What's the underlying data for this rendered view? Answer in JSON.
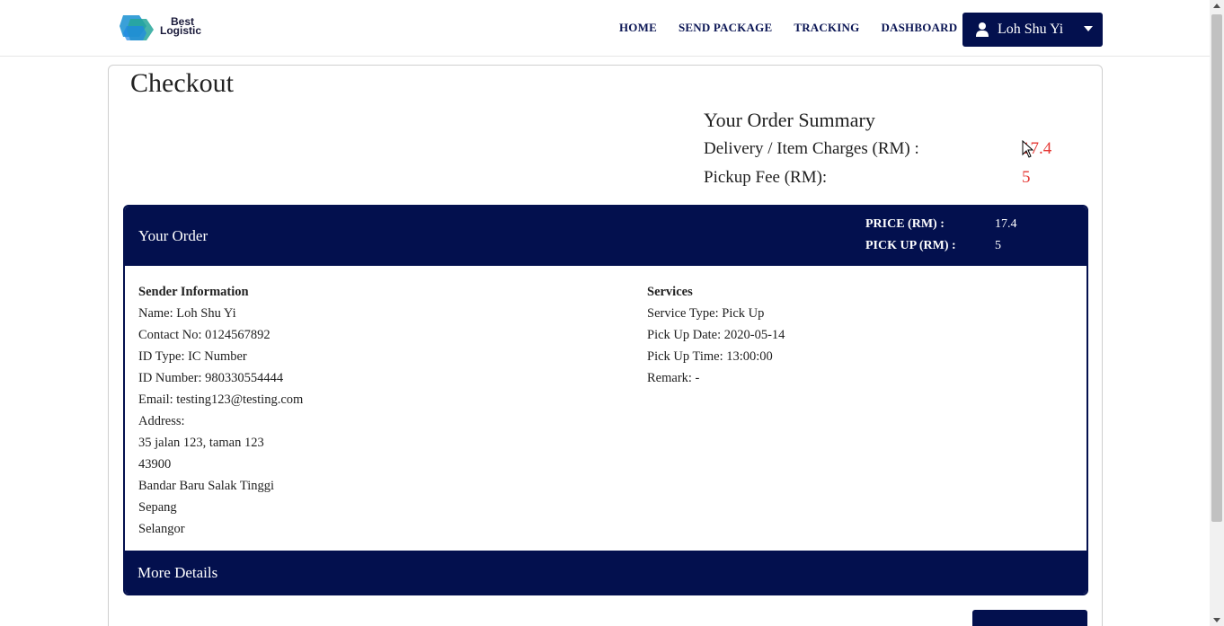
{
  "brand": {
    "logo_line1": "Best",
    "logo_line2": "Logistic"
  },
  "nav": {
    "links": [
      "HOME",
      "SEND PACKAGE",
      "TRACKING",
      "DASHBOARD"
    ],
    "user_name": "Loh Shu Yi"
  },
  "page_title": "Checkout",
  "summary": {
    "title": "Your Order Summary",
    "rows": [
      {
        "label": "Delivery / Item Charges (RM) :",
        "value": "17.4"
      },
      {
        "label": "Pickup Fee (RM):",
        "value": "5"
      }
    ]
  },
  "order": {
    "title": "Your Order",
    "price_label": "PRICE (RM) :",
    "price_value": "17.4",
    "pickup_label": "PICK UP (RM) :",
    "pickup_value": "5"
  },
  "sender": {
    "heading": "Sender Information",
    "lines": [
      "Name: Loh Shu Yi",
      "Contact No: 0124567892",
      "ID Type: IC Number",
      "ID Number: 980330554444",
      "Email: testing123@testing.com",
      "Address:",
      "35 jalan 123, taman 123",
      "43900",
      "Bandar Baru Salak Tinggi",
      "Sepang",
      "Selangor"
    ]
  },
  "services": {
    "heading": "Services",
    "lines": [
      "Service Type: Pick Up",
      "Pick Up Date: 2020-05-14",
      "Pick Up Time: 13:00:00",
      "Remark: -"
    ]
  },
  "more_details": "More Details",
  "colors": {
    "navy": "#03104e",
    "accent_red": "#e53935"
  },
  "icons": {
    "user": "user-icon",
    "caret": "caret-down-icon",
    "cursor": "mouse-cursor-icon"
  }
}
